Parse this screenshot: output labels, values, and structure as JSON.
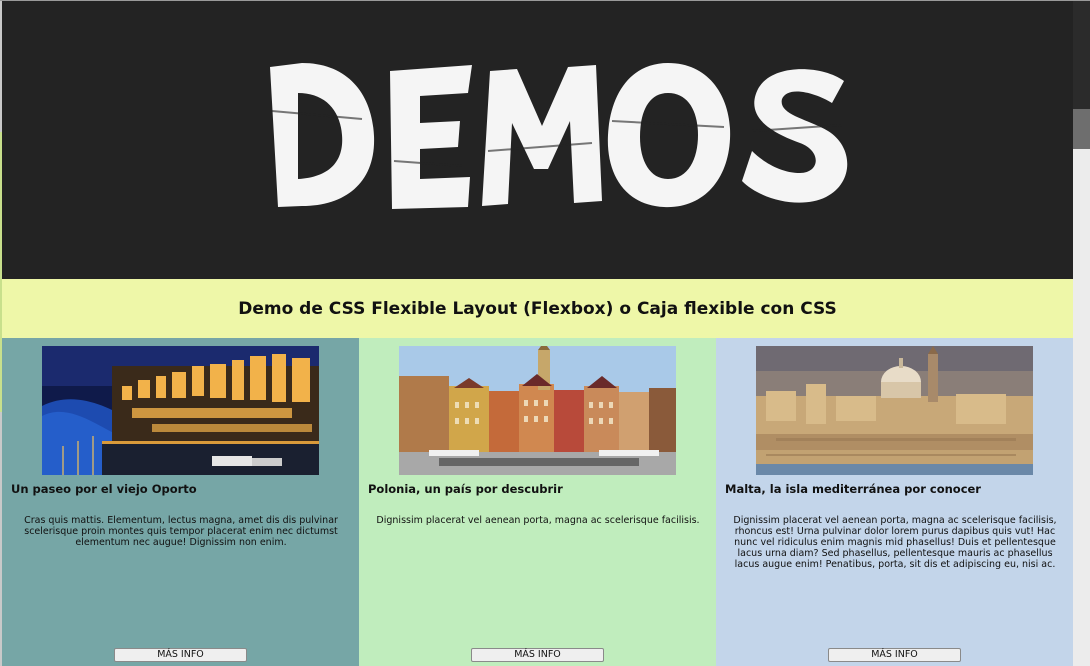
{
  "header": {
    "logo_text": "DEMOS"
  },
  "title": "Demo de CSS Flexible Layout (Flexbox) o Caja flexible con CSS",
  "columns": [
    {
      "image": "night-river-city-photo",
      "heading": "Un paseo por el viejo Oporto",
      "body": "Cras quis mattis. Elementum, lectus magna, amet dis dis pulvinar scelerisque proin montes quis tempor placerat enim nec dictumst elementum nec augue! Dignissim non enim.",
      "button": "MÁS INFO",
      "background": "#76a6a6"
    },
    {
      "image": "old-town-square-photo",
      "heading": "Polonia, un país por descubrir",
      "body": "Dignissim placerat vel aenean porta, magna ac scelerisque facilisis.",
      "button": "MÁS INFO",
      "background": "#c0edbd"
    },
    {
      "image": "valletta-skyline-photo",
      "heading": "Malta, la isla mediterránea por conocer",
      "body": "Dignissim placerat vel aenean porta, magna ac scelerisque facilisis, rhoncus est! Urna pulvinar dolor lorem purus dapibus quis vut! Hac nunc vel ridiculus enim magnis mid phasellus! Duis et pellentesque lacus urna diam? Sed phasellus, pellentesque mauris ac phasellus lacus augue enim! Penatibus, porta, sit dis et adipiscing eu, nisi ac.",
      "button": "MÁS INFO",
      "background": "#c3d5ea"
    }
  ],
  "colors": {
    "header_bg": "#232323",
    "title_bg": "#eef7a8"
  }
}
